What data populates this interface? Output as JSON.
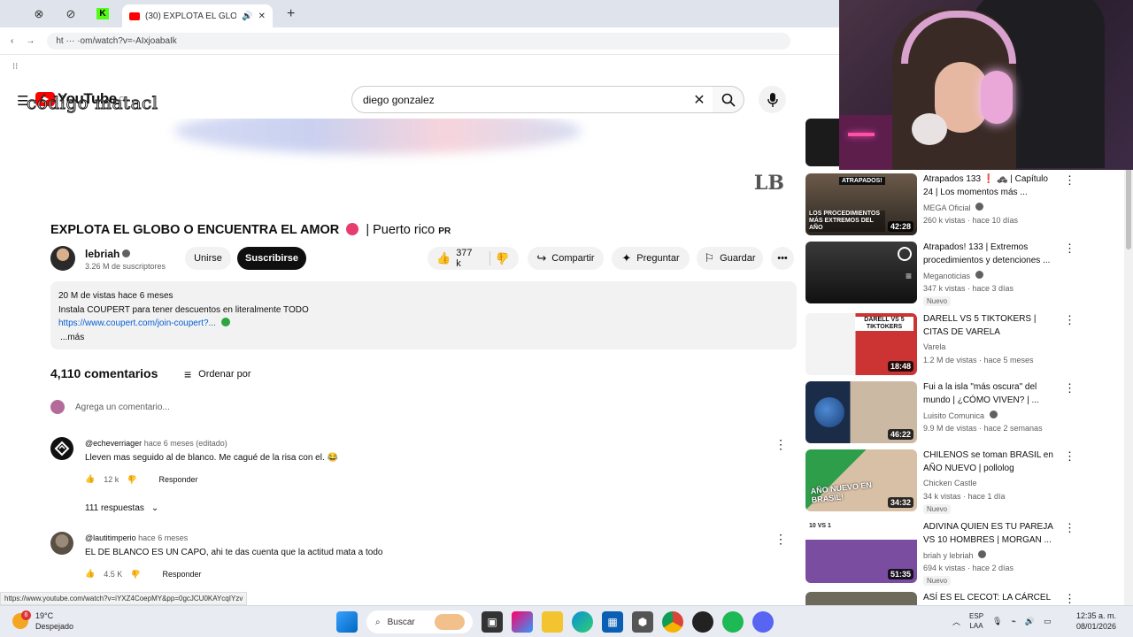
{
  "browser": {
    "tab_title": "(30) EXPLOTA EL GLOBO O |",
    "url": "ht  ···  ·om/watch?v=-AIxjoabaIk",
    "status_url": "https://www.youtube.com/watch?v=iYXZ4CoepMY&pp=0gcJCU0KAYcqIYzv"
  },
  "header": {
    "logo": "YouTube",
    "logo_region": "CL",
    "watermark": "código matacl",
    "search_value": "diego gonzalez"
  },
  "video": {
    "title": "EXPLOTA EL GLOBO O ENCUENTRA EL AMOR",
    "title_rest": "| Puerto rico",
    "title_flag": "PR",
    "channel": "lebriah",
    "subscribers": "3.26 M de suscriptores",
    "join_label": "Unirse",
    "subscribe_label": "Suscribirse",
    "likes": "377 k",
    "share_label": "Compartir",
    "ask_label": "Preguntar",
    "save_label": "Guardar"
  },
  "description": {
    "meta": "20 M de vistas  hace 6 meses",
    "line1": "Instala COUPERT para tener descuentos en literalmente TODO",
    "link": "https://www.coupert.com/join-coupert?...",
    "more": "...más"
  },
  "comments": {
    "count": "4,110 comentarios",
    "sort_label": "Ordenar por",
    "add_placeholder": "Agrega un comentario...",
    "items": [
      {
        "user": "@echeverriager",
        "when": "hace 6 meses (editado)",
        "text": "Lleven mas seguido al de blanco. Me cagué de la risa con el. 😂",
        "likes": "12 k",
        "reply": "Responder",
        "replies": "111 respuestas"
      },
      {
        "user": "@lautitimperio",
        "when": "hace 6 meses",
        "text": "EL DE BLANCO ES UN CAPO, ahi te das cuenta que la actitud mata a todo",
        "likes": "4.5 K",
        "reply": "Responder"
      }
    ]
  },
  "sidebar": [
    {
      "title": "Atrapados 133 ❗ 🚓 | Capítulo 24 | Los momentos más ...",
      "channel": "MEGA Oficial",
      "meta": "260 k vistas · hace 10 días",
      "duration": "42:28",
      "thumb_caption": "LOS PROCEDIMIENTOS MÁS EXTREMOS DEL AÑO",
      "thumb_tag": "ATRAPADOS!"
    },
    {
      "title": "Atrapados! 133 | Extremos procedimientos y detenciones ...",
      "channel": "Meganoticias",
      "meta": "347 k vistas · hace 3 días",
      "badge": "Nuevo"
    },
    {
      "title": "DARELL VS 5 TIKTOKERS | CITAS DE VARELA",
      "channel": "Varela",
      "meta": "1.2 M de vistas · hace 5 meses",
      "duration": "18:48",
      "thumb_caption": "DARELL VS 5 TIKTOKERS"
    },
    {
      "title": "Fui a la isla \"más oscura\" del mundo | ¿CÓMO VIVEN? | ...",
      "channel": "Luisito Comunica",
      "meta": "9.9 M de vistas · hace 2 semanas",
      "duration": "46:22"
    },
    {
      "title": "CHILENOS se toman BRASIL en AÑO NUEVO | pollolog",
      "channel": "Chicken Castle",
      "meta": "34 k vistas · hace 1 día",
      "badge": "Nuevo",
      "duration": "34:32",
      "thumb_caption": "AÑO NUEVO EN BRASIL!"
    },
    {
      "title": "ADIVINA QUIEN ES TU PAREJA VS 10 HOMBRES | MORGAN ...",
      "channel": "briah y lebriah",
      "meta": "694 k vistas · hace 2 días",
      "badge": "Nuevo",
      "duration": "51:35",
      "thumb_tag": "10 VS 1"
    },
    {
      "title": "ASÍ ES EL CECOT: LA CÁRCEL"
    }
  ],
  "taskbar": {
    "temp": "19°C",
    "weather": "Despejado",
    "weather_badge": "6",
    "search": "Buscar",
    "lang1": "ESP",
    "lang2": "LAA",
    "time": "12:35 a. m.",
    "date": "08/01/2026"
  }
}
